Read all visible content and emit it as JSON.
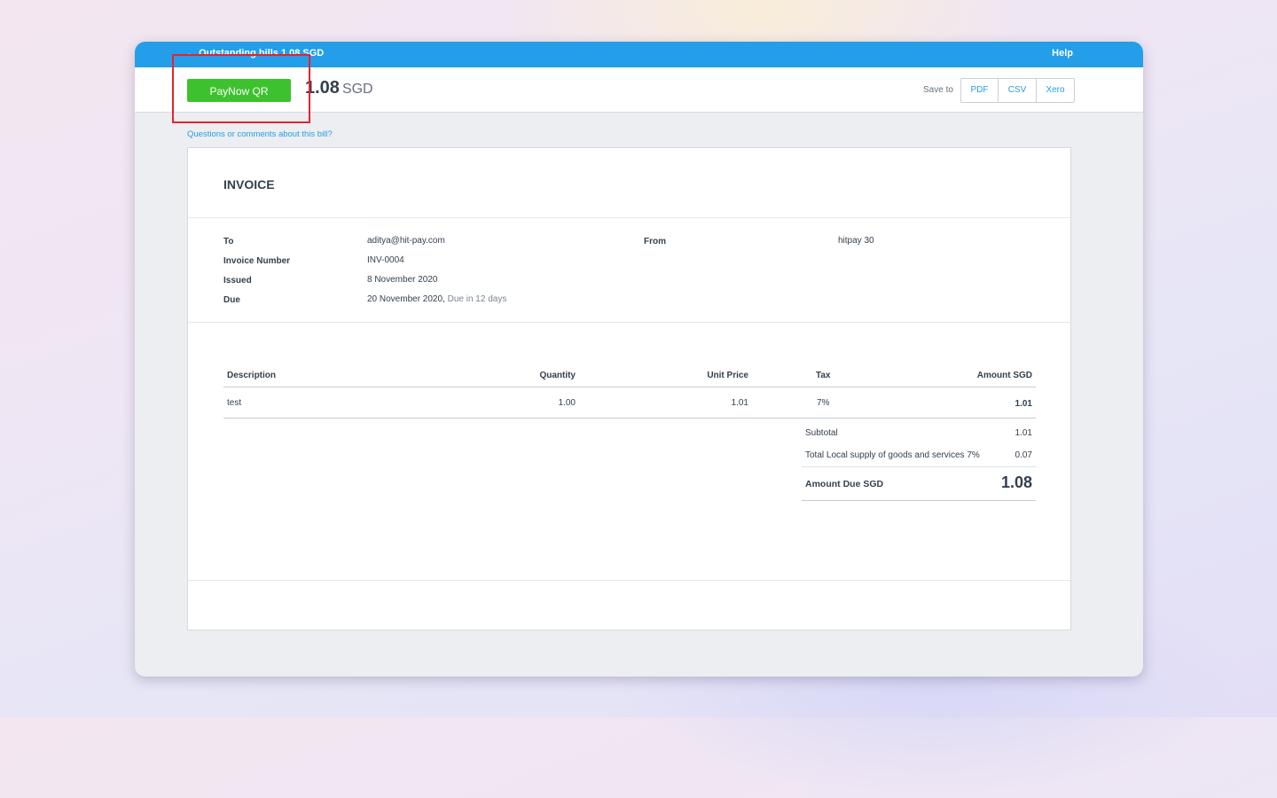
{
  "header": {
    "back_text": "Outstanding bills 1.08 SGD",
    "help_label": "Help"
  },
  "actionbar": {
    "pay_button_label": "PayNow QR",
    "amount": "1.08",
    "currency": "SGD",
    "save_to_label": "Save to",
    "save_options": [
      "PDF",
      "CSV",
      "Xero"
    ]
  },
  "questions_link": "Questions or comments about this bill?",
  "invoice": {
    "title": "INVOICE",
    "labels": {
      "to": "To",
      "invoice_number": "Invoice Number",
      "issued": "Issued",
      "due": "Due",
      "from": "From"
    },
    "values": {
      "to": "aditya@hit-pay.com",
      "invoice_number": "INV-0004",
      "issued": "8 November 2020",
      "due_date": "20 November 2020,",
      "due_note": "Due in 12 days",
      "from": "hitpay 30"
    },
    "table": {
      "columns": [
        "Description",
        "Quantity",
        "Unit Price",
        "Tax",
        "Amount SGD"
      ],
      "rows": [
        {
          "description": "test",
          "quantity": "1.00",
          "unit_price": "1.01",
          "tax": "7%",
          "amount": "1.01"
        }
      ]
    },
    "totals": {
      "subtotal_label": "Subtotal",
      "subtotal_value": "1.01",
      "tax_label": "Total Local supply of goods and services 7%",
      "tax_value": "0.07",
      "amount_due_label": "Amount Due SGD",
      "amount_due_value": "1.08"
    }
  },
  "colors": {
    "topbar": "#249ee8",
    "pay_button": "#3ec12e",
    "highlight_box": "#e4232e"
  }
}
